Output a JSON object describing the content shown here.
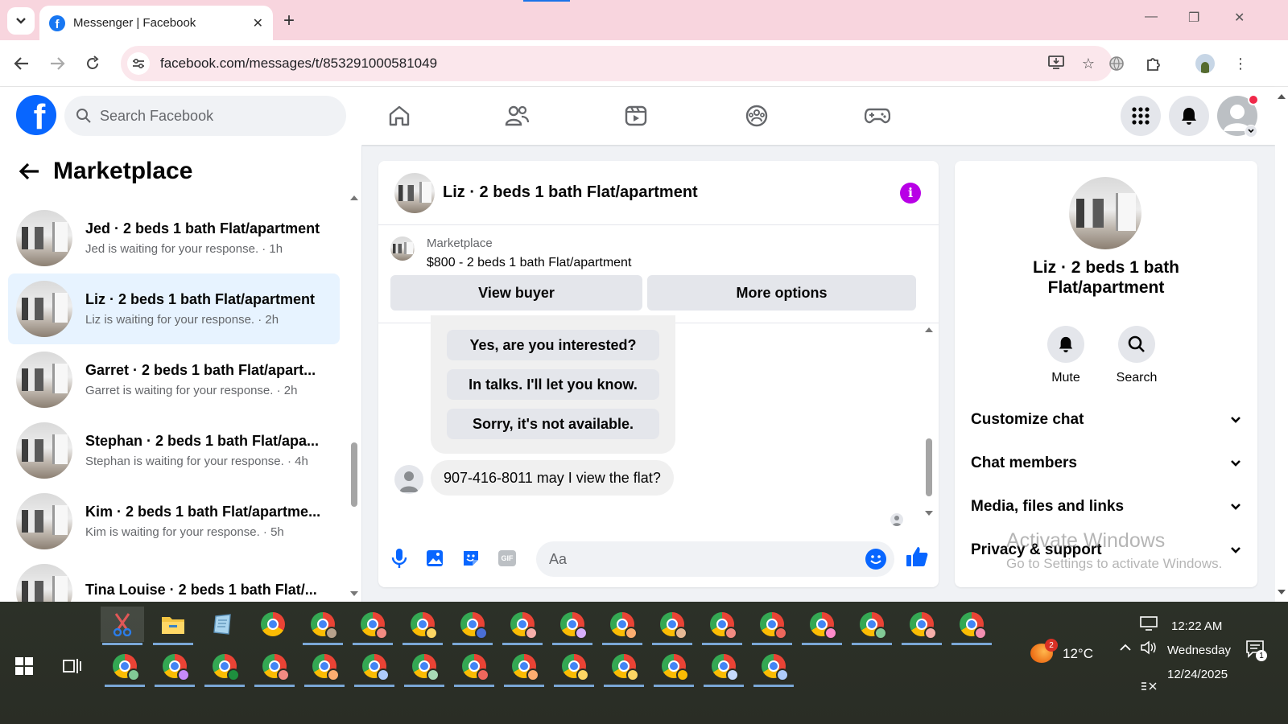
{
  "browser": {
    "tab_title": "Messenger | Facebook",
    "url": "facebook.com/messages/t/853291000581049"
  },
  "header": {
    "search_placeholder": "Search Facebook"
  },
  "sidebar": {
    "title": "Marketplace",
    "chats": [
      {
        "name": "Jed · 2 beds 1 bath Flat/apartment",
        "sub": "Jed is waiting for your response. · 1h"
      },
      {
        "name": "Liz · 2 beds 1 bath Flat/apartment",
        "sub": "Liz is waiting for your response. · 2h"
      },
      {
        "name": "Garret · 2 beds 1 bath Flat/apart...",
        "sub": "Garret is waiting for your response. · 2h"
      },
      {
        "name": "Stephan · 2 beds 1 bath Flat/apa...",
        "sub": "Stephan is waiting for your response. · 4h"
      },
      {
        "name": "Kim · 2 beds 1 bath Flat/apartme...",
        "sub": "Kim is waiting for your response. · 5h"
      },
      {
        "name": "Tina Louise · 2 beds 1 bath Flat/...",
        "sub": ""
      }
    ]
  },
  "conversation": {
    "title": "Liz · 2 beds 1 bath Flat/apartment",
    "marketplace_label": "Marketplace",
    "listing": "$800 - 2 beds 1 bath Flat/apartment",
    "view_buyer": "View buyer",
    "more_options": "More options",
    "quick_replies": [
      "Yes, are you interested?",
      "In talks. I'll let you know.",
      "Sorry, it's not available."
    ],
    "message": "907-416-8011 may I view the flat?",
    "input_placeholder": "Aa"
  },
  "info_panel": {
    "title": "Liz · 2 beds 1 bath Flat/apartment",
    "mute": "Mute",
    "search": "Search",
    "sections": [
      "Customize chat",
      "Chat members",
      "Media, files and links",
      "Privacy & support"
    ]
  },
  "watermark": {
    "line1": "Activate Windows",
    "line2": "Go to Settings to activate Windows."
  },
  "taskbar": {
    "weather_temp": "12°C",
    "weather_badge": "2",
    "time": "12:22 AM",
    "day": "Wednesday",
    "date": "12/24/2025",
    "notification_count": "1"
  },
  "colors": {
    "facebook_blue": "#0866ff",
    "active_chat_bg": "#e7f3ff",
    "info_purple": "#b800e6",
    "tabbar_pink": "#f8d5de"
  }
}
